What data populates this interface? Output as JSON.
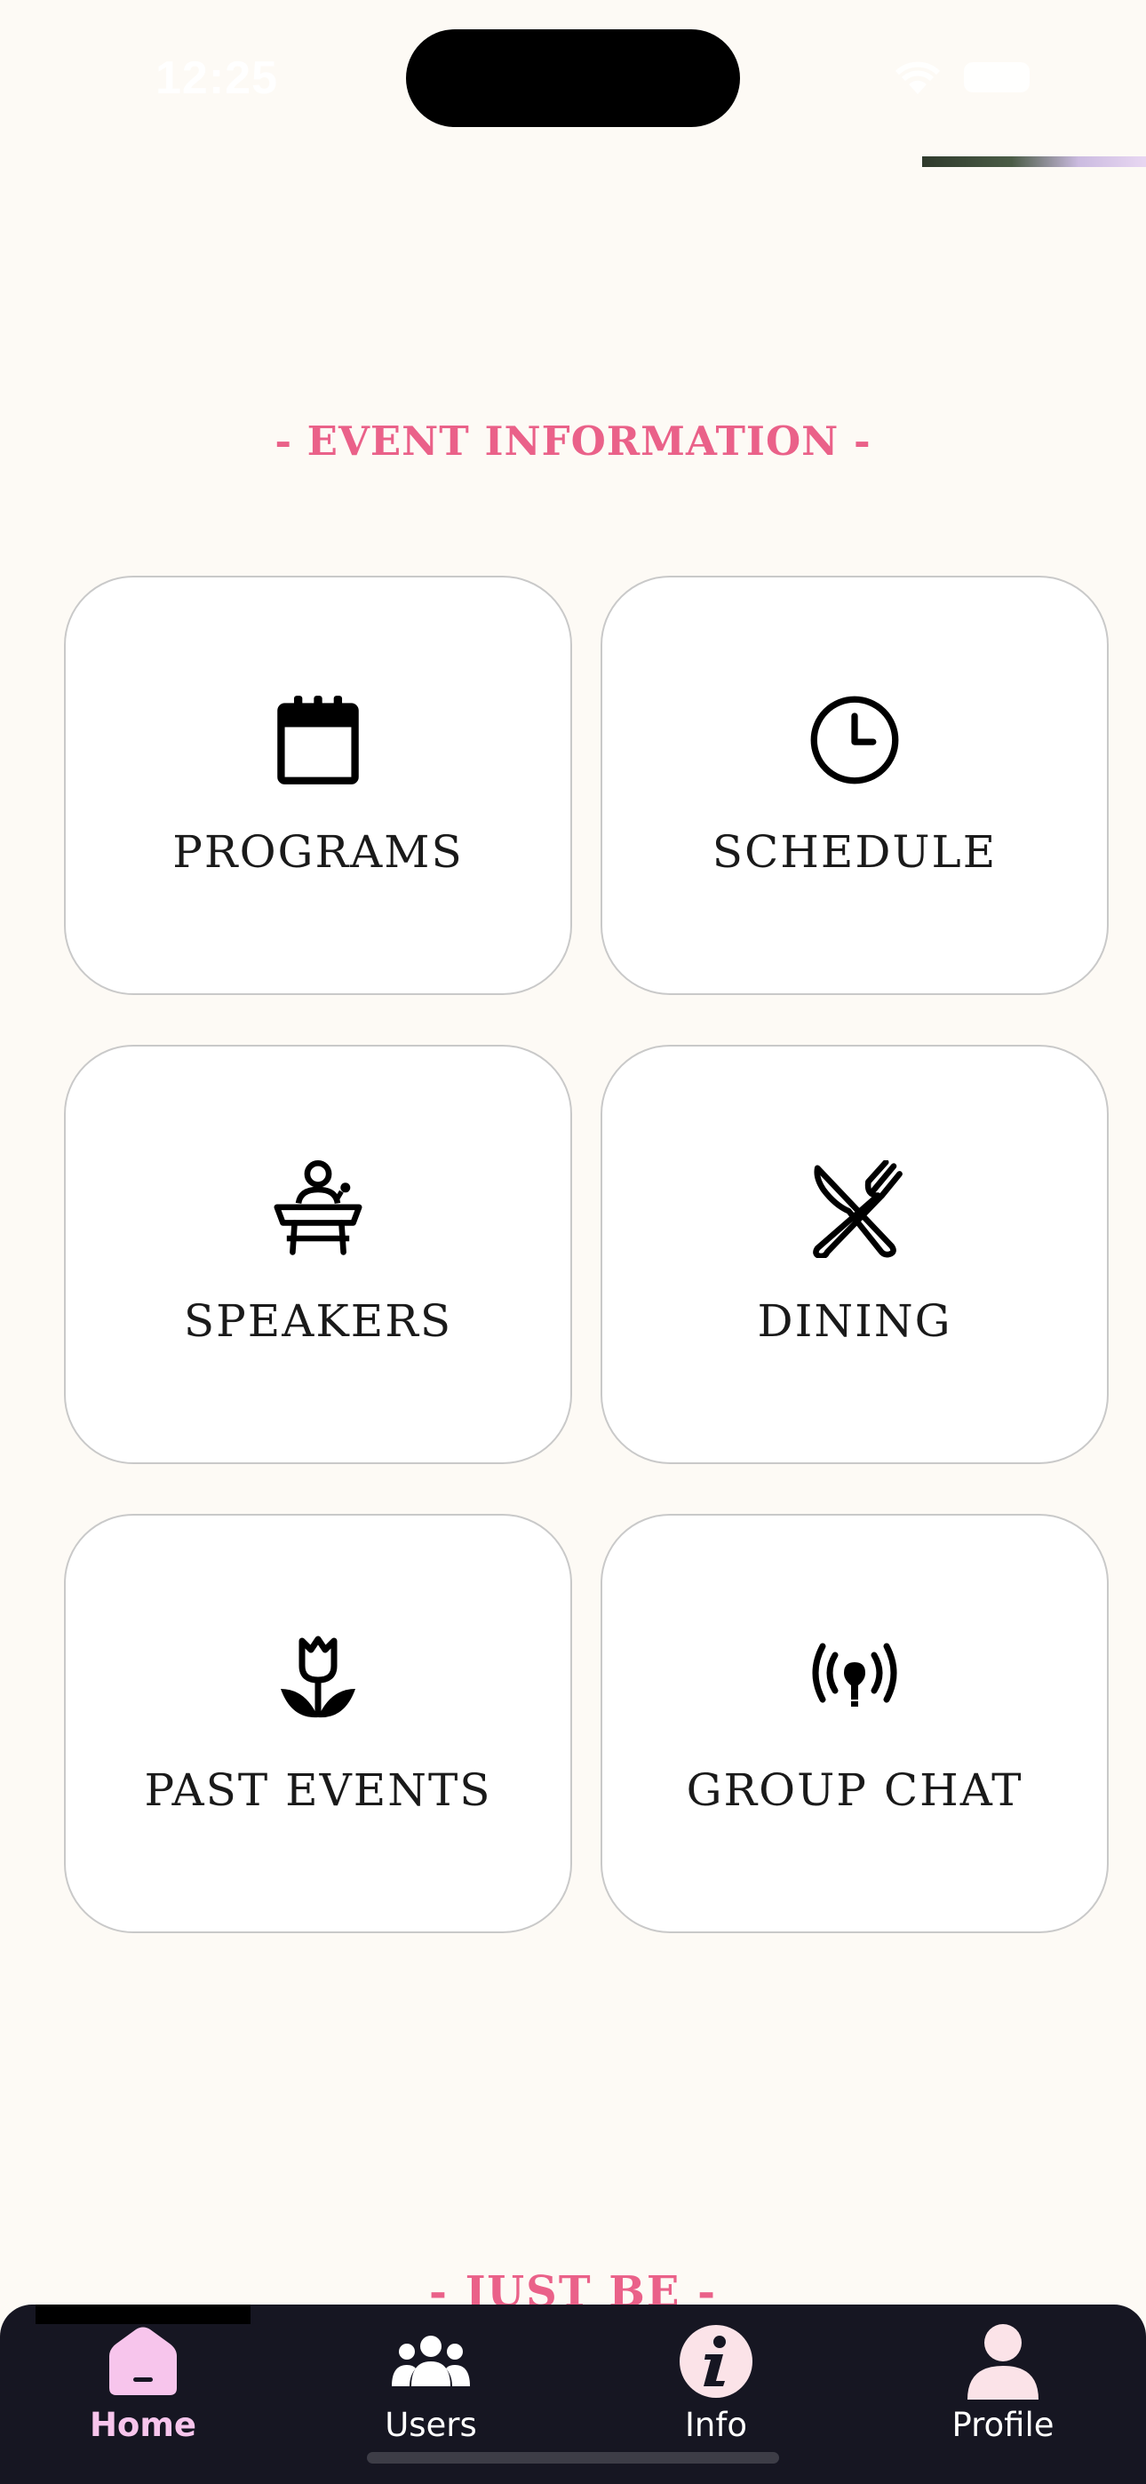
{
  "status_bar": {
    "time": "12:25"
  },
  "section": {
    "title": "-  EVENT INFORMATION  -"
  },
  "cards": [
    {
      "label": "PROGRAMS",
      "icon": "calendar-icon"
    },
    {
      "label": "SCHEDULE",
      "icon": "clock-icon"
    },
    {
      "label": "SPEAKERS",
      "icon": "speaker-podium-icon"
    },
    {
      "label": "DINING",
      "icon": "utensils-icon"
    },
    {
      "label": "PAST EVENTS",
      "icon": "tulip-icon"
    },
    {
      "label": "GROUP CHAT",
      "icon": "broadcast-icon"
    }
  ],
  "tagline": "- JUST BE -",
  "tabbar": {
    "tabs": [
      {
        "label": "Home",
        "icon": "home-icon",
        "active": true
      },
      {
        "label": "Users",
        "icon": "users-icon",
        "active": false
      },
      {
        "label": "Info",
        "icon": "info-icon",
        "active": false
      },
      {
        "label": "Profile",
        "icon": "profile-icon",
        "active": false
      }
    ]
  },
  "colors": {
    "accent": "#ea6189",
    "background": "#fdfaf5",
    "tabbar": "#161622",
    "active_tab": "#f7c5ec"
  }
}
